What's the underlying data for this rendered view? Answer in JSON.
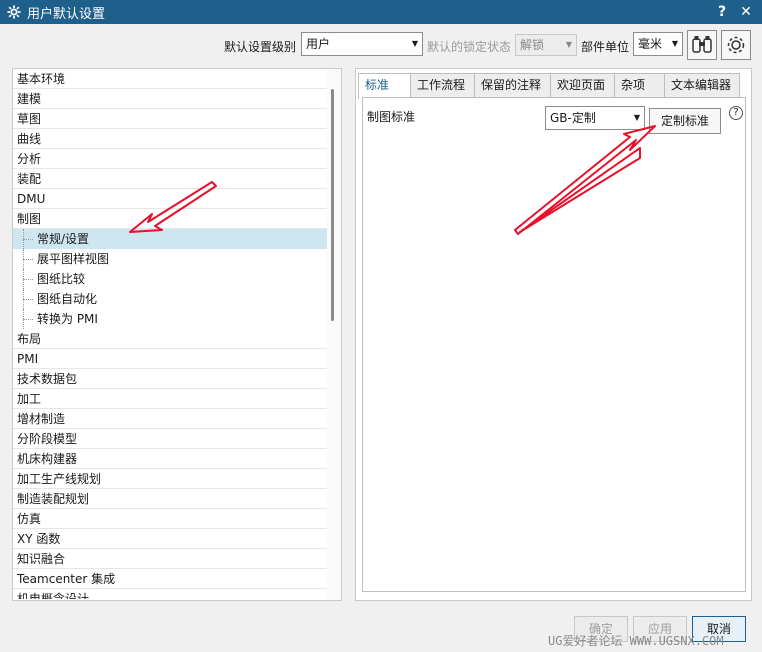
{
  "window": {
    "title": "用户默认设置",
    "help": "?",
    "close": "✕",
    "gear_icon": "gear-icon"
  },
  "toolbar": {
    "level_label": "默认设置级别",
    "level_value": "用户",
    "lock_label": "默认的锁定状态",
    "lock_value": "解锁",
    "unit_label": "部件单位",
    "unit_value": "毫米"
  },
  "tree": {
    "items": [
      "基本环境",
      "建模",
      "草图",
      "曲线",
      "分析",
      "装配",
      "DMU",
      "制图",
      "常规/设置",
      "展平图样视图",
      "图纸比较",
      "图纸自动化",
      "转换为 PMI",
      "布局",
      "PMI",
      "技术数据包",
      "加工",
      "增材制造",
      "分阶段模型",
      "机床构建器",
      "加工生产线规划",
      "制造装配规划",
      "仿真",
      "XY 函数",
      "知识融合",
      "Teamcenter 集成",
      "机电概念设计"
    ]
  },
  "tabs": [
    "标准",
    "工作流程",
    "保留的注释",
    "欢迎页面",
    "杂项",
    "文本编辑器"
  ],
  "standard": {
    "label": "制图标准",
    "value": "GB-定制",
    "custom_button": "定制标准"
  },
  "buttons": {
    "ok": "确定",
    "apply": "应用",
    "cancel": "取消"
  },
  "watermark": "UG爱好者论坛 WWW.UGSNX.COM",
  "colors": {
    "titlebar": "#1f5f8b",
    "selected": "#cde6f0",
    "arrow": "#e8102a"
  }
}
